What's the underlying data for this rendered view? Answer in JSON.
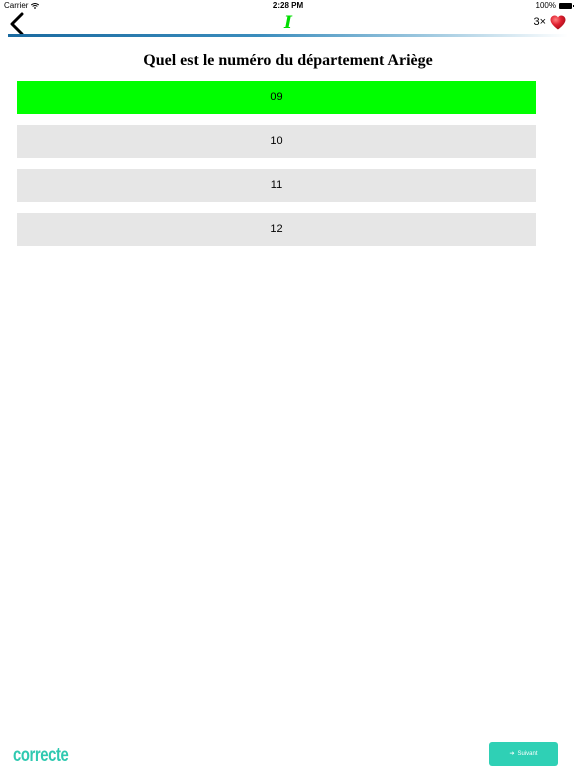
{
  "status_bar": {
    "carrier": "Carrier",
    "time": "2:28 PM",
    "battery": "100%"
  },
  "nav": {
    "logo": "I",
    "lives_count": "3×"
  },
  "question": {
    "title": "Quel est le numéro du département Ariège"
  },
  "answers": [
    {
      "label": "09",
      "state": "correct"
    },
    {
      "label": "10",
      "state": "neutral"
    },
    {
      "label": "11",
      "state": "neutral"
    },
    {
      "label": "12",
      "state": "neutral"
    }
  ],
  "footer": {
    "result": "correcte",
    "next_label": "Suivant",
    "next_icon": "skip-icon"
  },
  "colors": {
    "correct": "#00ff00",
    "neutral": "#e6e6e6",
    "accent": "#2fd0b5",
    "logo": "#00dd00",
    "heart": "#d9182b"
  }
}
